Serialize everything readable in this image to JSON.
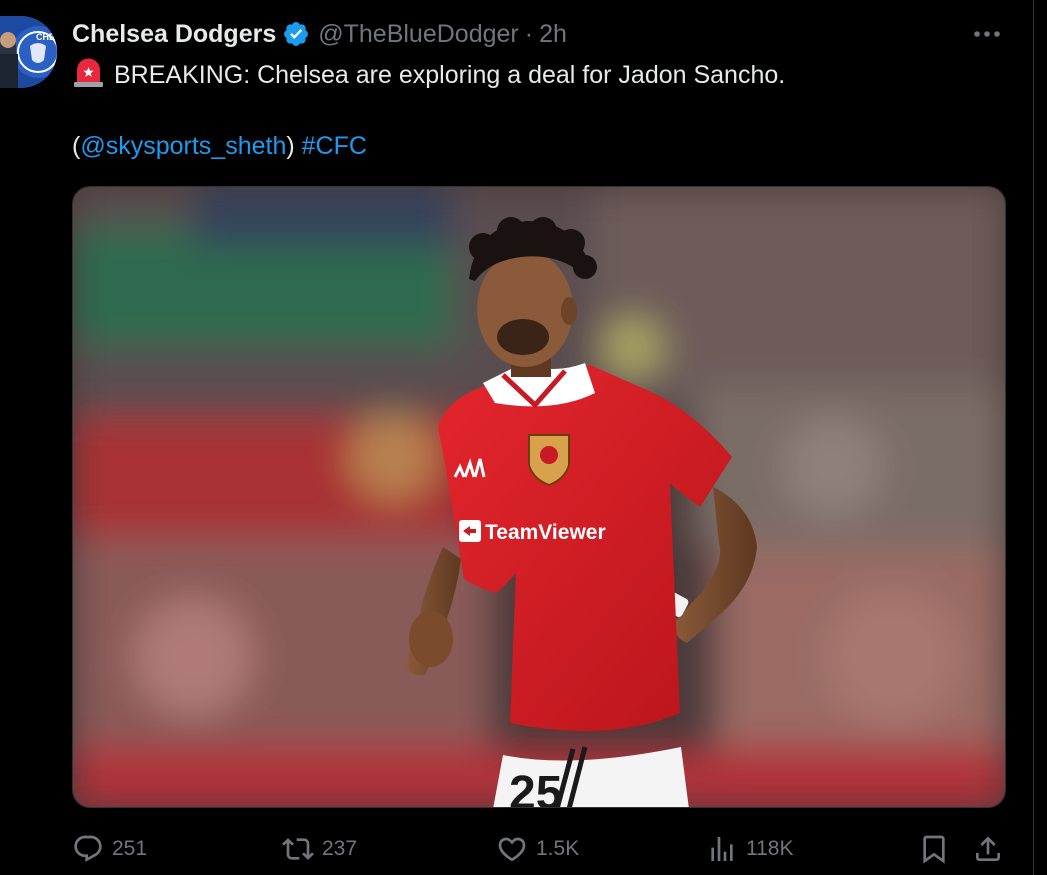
{
  "author": {
    "display_name": "Chelsea Dodgers",
    "handle": "@TheBlueDodger",
    "separator": "·",
    "time": "2h",
    "verified_color": "#1d9bf0"
  },
  "tweet": {
    "siren_icon": "siren-emoji-icon",
    "line1": "BREAKING: Chelsea are exploring a deal for Jadon Sancho.",
    "paren_open": "(",
    "mention": "@skysports_sheth",
    "paren_close": ")",
    "hashtag": "#CFC"
  },
  "media": {
    "shirt_sponsor": "TeamViewer",
    "shirt_number": "25"
  },
  "actions": {
    "replies": "251",
    "reposts": "237",
    "likes": "1.5K",
    "views": "118K"
  },
  "colors": {
    "background": "#000000",
    "text": "#e7e9ea",
    "secondary": "#71767b",
    "accent": "#1d9bf0"
  }
}
